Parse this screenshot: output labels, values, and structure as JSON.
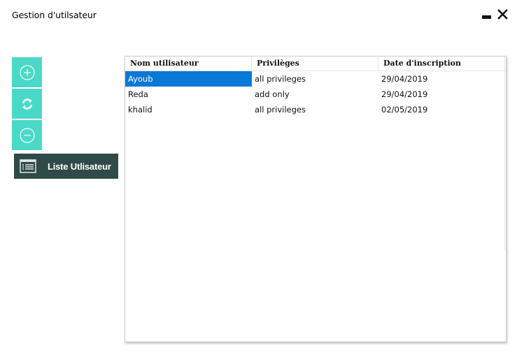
{
  "window": {
    "title": "Gestion d'utilsateur"
  },
  "sidebar": {
    "list_button_label": "Liste Utlisateur"
  },
  "table": {
    "columns": [
      "Nom utilisateur",
      "Privilèges",
      "Date d'inscription"
    ],
    "rows": [
      {
        "name": "Ayoub",
        "privileges": "all privileges",
        "date": "29/04/2019"
      },
      {
        "name": "Reda",
        "privileges": "add only",
        "date": "29/04/2019"
      },
      {
        "name": "khalid",
        "privileges": "all privileges",
        "date": "02/05/2019"
      }
    ],
    "selected_row": 0
  },
  "colors": {
    "tool_button": "#4ad9c6",
    "list_button": "#2f4a48",
    "selection": "#0a78d7"
  }
}
